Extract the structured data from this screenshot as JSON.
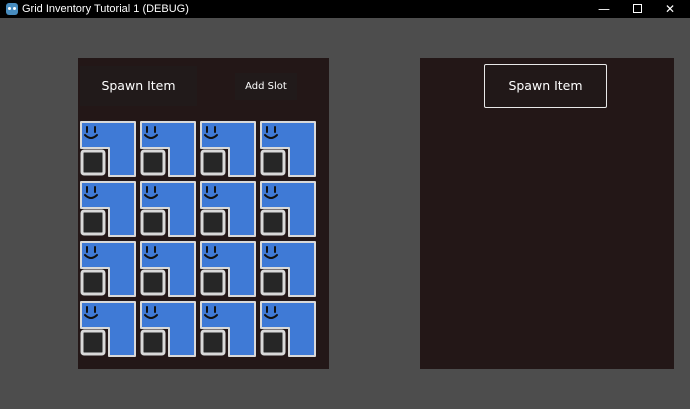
{
  "window": {
    "title": "Grid Inventory Tutorial 1 (DEBUG)",
    "minimize_glyph": "—",
    "close_glyph": "✕"
  },
  "left_panel": {
    "spawn_button_label": "Spawn Item",
    "add_slot_button_label": "Add Slot"
  },
  "right_panel": {
    "spawn_button_label": "Spawn Item"
  },
  "inventory": {
    "rows": 4,
    "columns": 4,
    "item_color": "#3f7ad6",
    "item_face": "smiley-icon"
  },
  "colors": {
    "background": "#4d4d4d",
    "panel": "#231717",
    "slot_border": "#d9d9d9",
    "slot_fill": "#262626"
  }
}
